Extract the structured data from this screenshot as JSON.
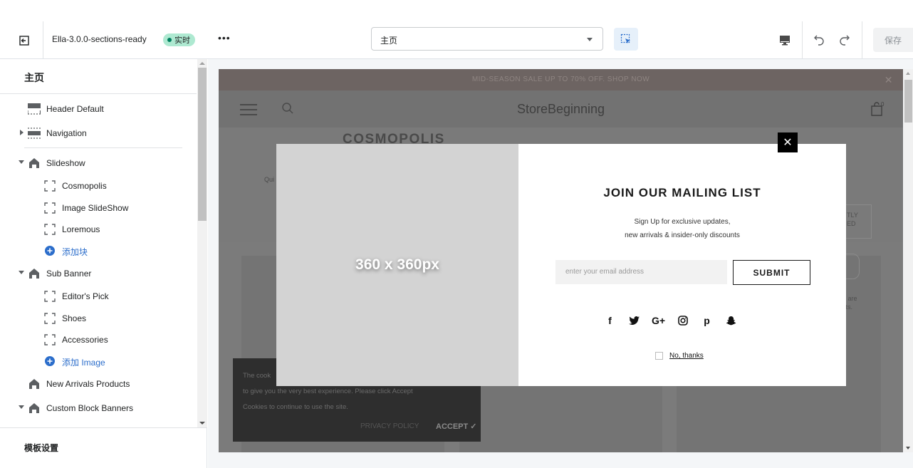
{
  "topbar": {
    "theme_name": "Ella-3.0.0-sections-ready",
    "status_badge": "实时",
    "more": "•••",
    "page_select": "主页",
    "save": "保存"
  },
  "sidebar": {
    "title": "主页",
    "items": [
      {
        "label": "Header Default"
      },
      {
        "label": "Navigation"
      },
      {
        "label": "Slideshow"
      },
      {
        "label": "Cosmopolis"
      },
      {
        "label": "Image SlideShow"
      },
      {
        "label": "Loremous"
      },
      {
        "label": "添加块"
      },
      {
        "label": "Sub Banner"
      },
      {
        "label": "Editor's Pick"
      },
      {
        "label": "Shoes"
      },
      {
        "label": "Accessories"
      },
      {
        "label": "添加 Image"
      },
      {
        "label": "New Arrivals Products"
      },
      {
        "label": "Custom Block Banners"
      }
    ],
    "footer": "模板设置"
  },
  "store": {
    "announcement": "MID-SEASON SALE UP TO 70% OFF. SHOP NOW",
    "brand": "StoreBeginning",
    "cart_count": "0",
    "slide_title": "COSMOPOLIS",
    "slide_text": "Qui",
    "faint_1": "TLY",
    "faint_2": "ED",
    "faint_3": "e are",
    "faint_4": "cts."
  },
  "cookie": {
    "text_1": "The cook",
    "text_2": "to give you the very best experience. Please click Accept",
    "text_3": "Cookies to continue to use the site.",
    "privacy": "PRIVACY POLICY",
    "accept": "ACCEPT ✓"
  },
  "popup": {
    "image_placeholder": "360 x 360px",
    "title": "JOIN OUR MAILING LIST",
    "subtitle_1": "Sign Up for exclusive updates,",
    "subtitle_2": "new arrivals & insider-only discounts",
    "email_placeholder": "enter your email address",
    "submit": "SUBMIT",
    "social": [
      "f",
      "G+",
      "p"
    ],
    "no_thanks": "No, thanks",
    "close": "✕"
  }
}
